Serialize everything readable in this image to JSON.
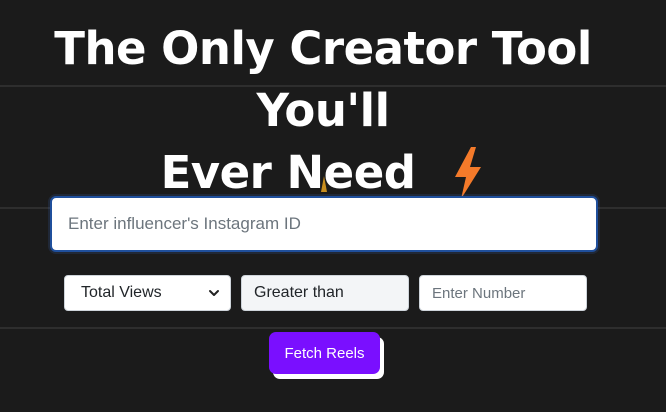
{
  "hero": {
    "title_line1": "The Only Creator Tool You'll",
    "title_line2": "Ever Need",
    "icon": "lightning-bolt-icon",
    "icon_color": "#f47a2a"
  },
  "search": {
    "placeholder": "Enter influencer's Instagram ID",
    "value": ""
  },
  "filters": {
    "metric_selected": "Total Views",
    "condition": "Greater than",
    "number_placeholder": "Enter Number",
    "number_value": ""
  },
  "actions": {
    "fetch_label": "Fetch Reels",
    "fetch_color": "#7a0fff"
  },
  "theme": {
    "background": "#1b1b1b"
  }
}
